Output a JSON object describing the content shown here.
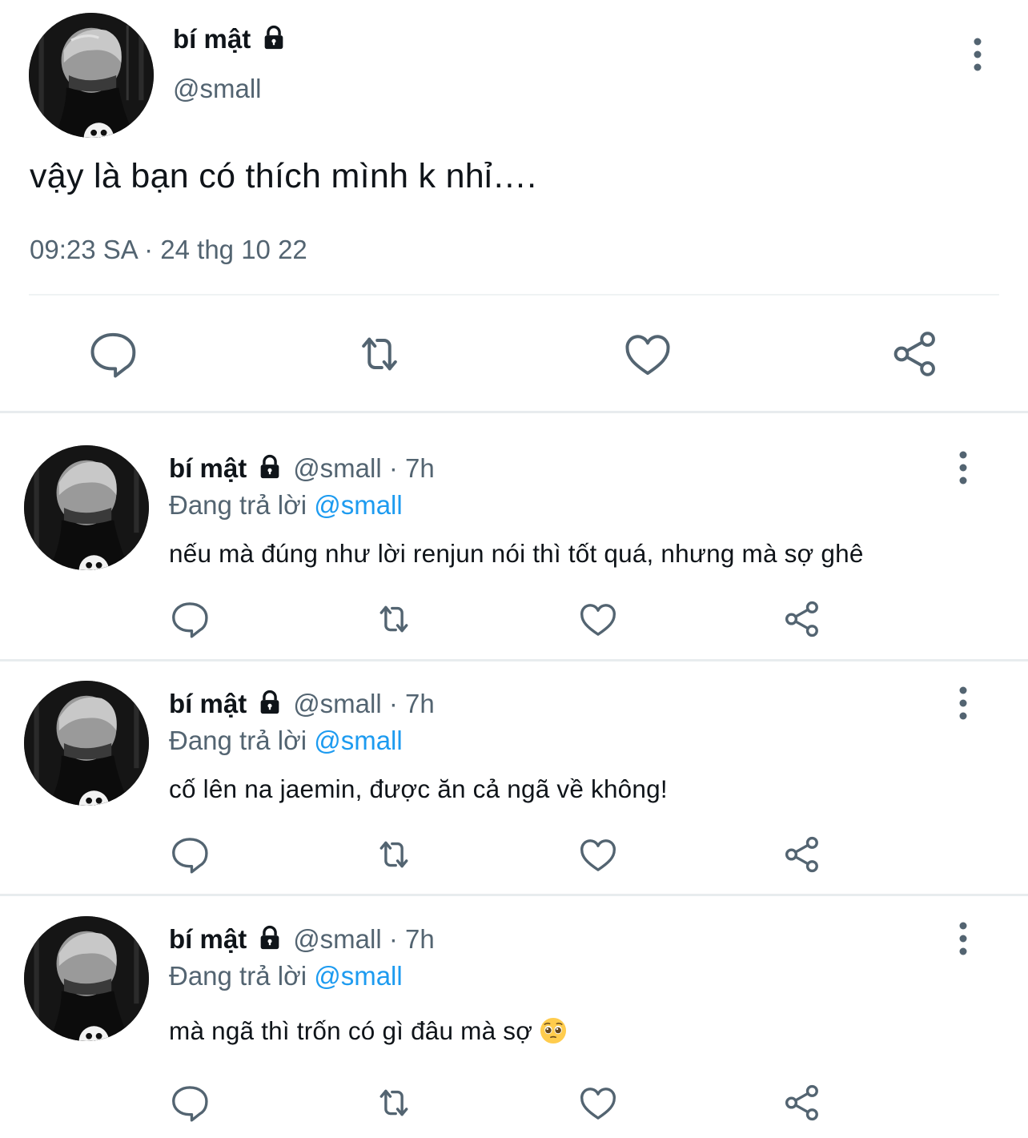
{
  "main_tweet": {
    "display_name": "bí mật",
    "handle": "@small",
    "text": "vậy là bạn có thích mình k nhỉ….",
    "timestamp": "09:23 SA · 24 thg 10 22",
    "actions": [
      "reply-icon",
      "retweet-icon",
      "like-icon",
      "share-icon"
    ]
  },
  "replies": [
    {
      "display_name": "bí mật",
      "handle_time": "@small · 7h",
      "replying_prefix": "Đang trả lời",
      "replying_to": "@small",
      "text": "nếu mà đúng như lời renjun nói thì tốt quá, nhưng mà sợ ghê"
    },
    {
      "display_name": "bí mật",
      "handle_time": "@small · 7h",
      "replying_prefix": "Đang trả lời",
      "replying_to": "@small",
      "text": "cố lên na jaemin, được ăn cả ngã về không!"
    },
    {
      "display_name": "bí mật",
      "handle_time": "@small · 7h",
      "replying_prefix": "Đang trả lời",
      "replying_to": "@small",
      "text": "mà ngã thì trốn có gì đâu mà sợ",
      "emoji": "pleading-face-emoji"
    }
  ],
  "colors": {
    "text_primary": "#0f1419",
    "text_secondary": "#536471",
    "mention": "#1d9bf0",
    "icon": "#536471",
    "divider": "#eff3f4"
  }
}
